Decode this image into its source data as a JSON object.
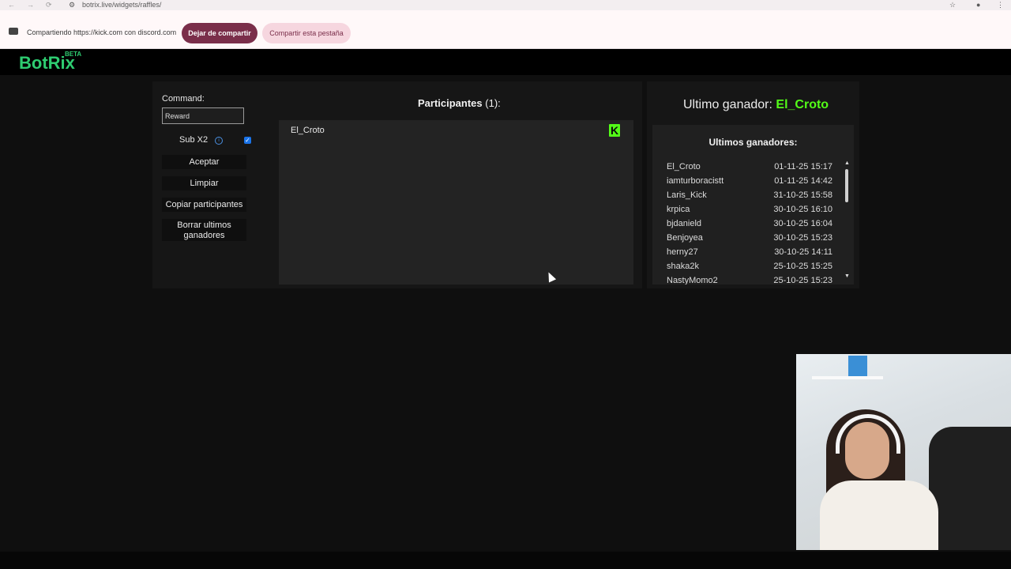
{
  "browser": {
    "url": "botrix.live/widgets/raffles/"
  },
  "share_bar": {
    "message": "Compartiendo https://kick.com con discord.com",
    "stop_button": "Dejar de compartir",
    "share_tab_button": "Compartir esta pestaña"
  },
  "header": {
    "logo": "BotRix",
    "badge": "BETA"
  },
  "controls": {
    "command_label": "Command:",
    "command_value": "Reward",
    "sub_label": "Sub X2",
    "sub_checked": true,
    "accept_button": "Aceptar",
    "clear_button": "Limpiar",
    "copy_button": "Copiar participantes",
    "delete_winners_button": "Borrar ultimos ganadores"
  },
  "participants": {
    "title": "Participantes",
    "count": "(1):",
    "items": [
      {
        "name": "El_Croto",
        "platform_icon": "kick-icon"
      }
    ]
  },
  "winner": {
    "label": "Ultimo ganador:",
    "name": "El_Croto",
    "color": "#53fc18"
  },
  "recent_winners": {
    "title": "Ultimos ganadores:",
    "rows": [
      {
        "name": "El_Croto",
        "date": "01-11-25 15:17"
      },
      {
        "name": "iamturboracistt",
        "date": "01-11-25 14:42"
      },
      {
        "name": "Laris_Kick",
        "date": "31-10-25 15:58"
      },
      {
        "name": "krpica",
        "date": "30-10-25 16:10"
      },
      {
        "name": "bjdanield",
        "date": "30-10-25 16:04"
      },
      {
        "name": "Benjoyea",
        "date": "30-10-25 15:23"
      },
      {
        "name": "herny27",
        "date": "30-10-25 14:11"
      },
      {
        "name": "shaka2k",
        "date": "25-10-25 15:25"
      },
      {
        "name": "NastyMomo2",
        "date": "25-10-25 15:23"
      }
    ]
  },
  "colors": {
    "brand_green": "#2ecc71",
    "kick_green": "#53fc18",
    "stop_button": "#7a2e4a",
    "share_button": "#f6d6df"
  }
}
